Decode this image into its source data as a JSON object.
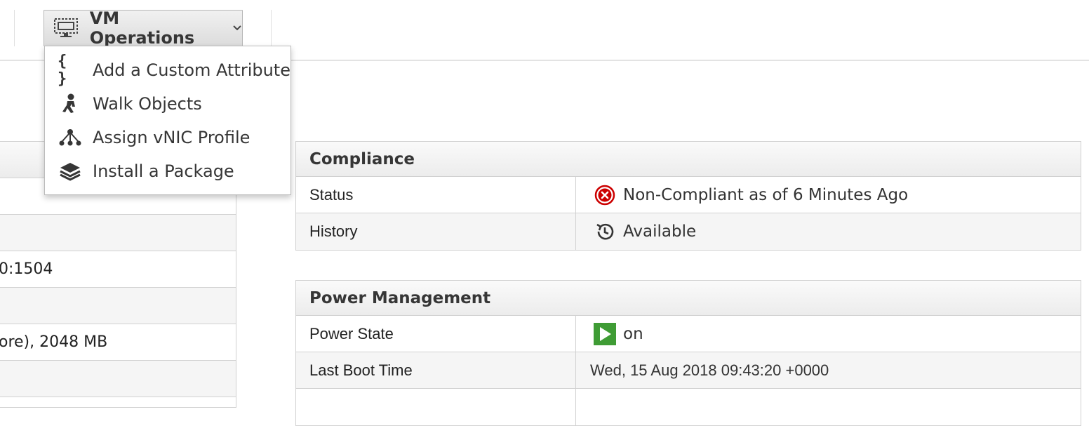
{
  "toolbar": {
    "vm_operations": {
      "label": "VM Operations",
      "icon": "vm-monitor-icon"
    }
  },
  "dropdown": {
    "items": [
      {
        "label": "Add a Custom Attribute",
        "icon": "braces-icon",
        "glyph": "{ }"
      },
      {
        "label": "Walk Objects",
        "icon": "walking-person-icon"
      },
      {
        "label": "Assign vNIC Profile",
        "icon": "network-nodes-icon"
      },
      {
        "label": "Install a Package",
        "icon": "stack-layers-icon"
      }
    ]
  },
  "left_panel": {
    "rows": [
      {
        "text": ""
      },
      {
        "text": ""
      },
      {
        "text": ""
      },
      {
        "text": "0:1504"
      },
      {
        "text": ""
      },
      {
        "text": "ore), 2048 MB"
      },
      {
        "text": ""
      }
    ]
  },
  "compliance": {
    "title": "Compliance",
    "rows": [
      {
        "label": "Status",
        "value": "Non-Compliant as of 6 Minutes Ago",
        "icon": "error-circle-icon"
      },
      {
        "label": "History",
        "value": "Available",
        "icon": "history-icon"
      }
    ]
  },
  "power": {
    "title": "Power Management",
    "rows": [
      {
        "label": "Power State",
        "value": "on",
        "icon": "play-icon"
      },
      {
        "label": "Last Boot Time",
        "value": "Wed, 15 Aug 2018 09:43:20 +0000"
      }
    ]
  },
  "colors": {
    "error_red": "#cc0000",
    "power_on_green": "#3f9c35",
    "border": "#d1d1d1"
  }
}
